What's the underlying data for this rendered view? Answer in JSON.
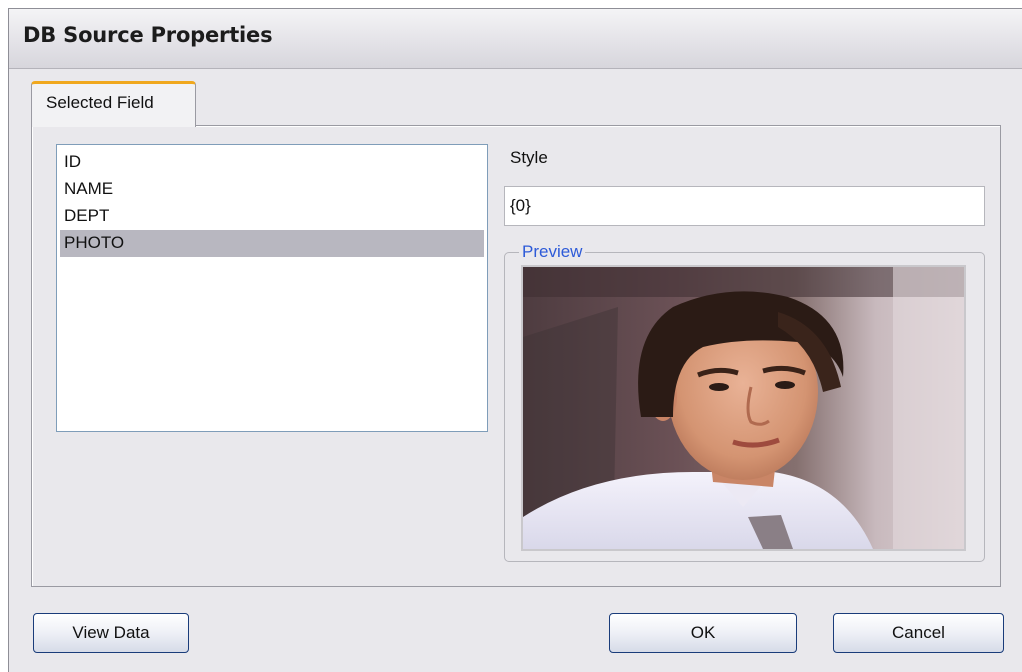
{
  "window": {
    "title": "DB Source Properties"
  },
  "tabs": [
    {
      "label": "Selected Field",
      "active": true
    }
  ],
  "field_list": {
    "items": [
      "ID",
      "NAME",
      "DEPT",
      "PHOTO"
    ],
    "selected": "PHOTO"
  },
  "style": {
    "label": "Style",
    "value": "{0}"
  },
  "preview": {
    "legend": "Preview",
    "image": "portrait-photo"
  },
  "buttons": {
    "view_data": "View Data",
    "ok": "OK",
    "cancel": "Cancel"
  },
  "colors": {
    "tab_accent": "#f0a81e",
    "preview_legend": "#2d5ad8",
    "selection": "#b8b7c0",
    "button_border": "#1a3c7a"
  }
}
